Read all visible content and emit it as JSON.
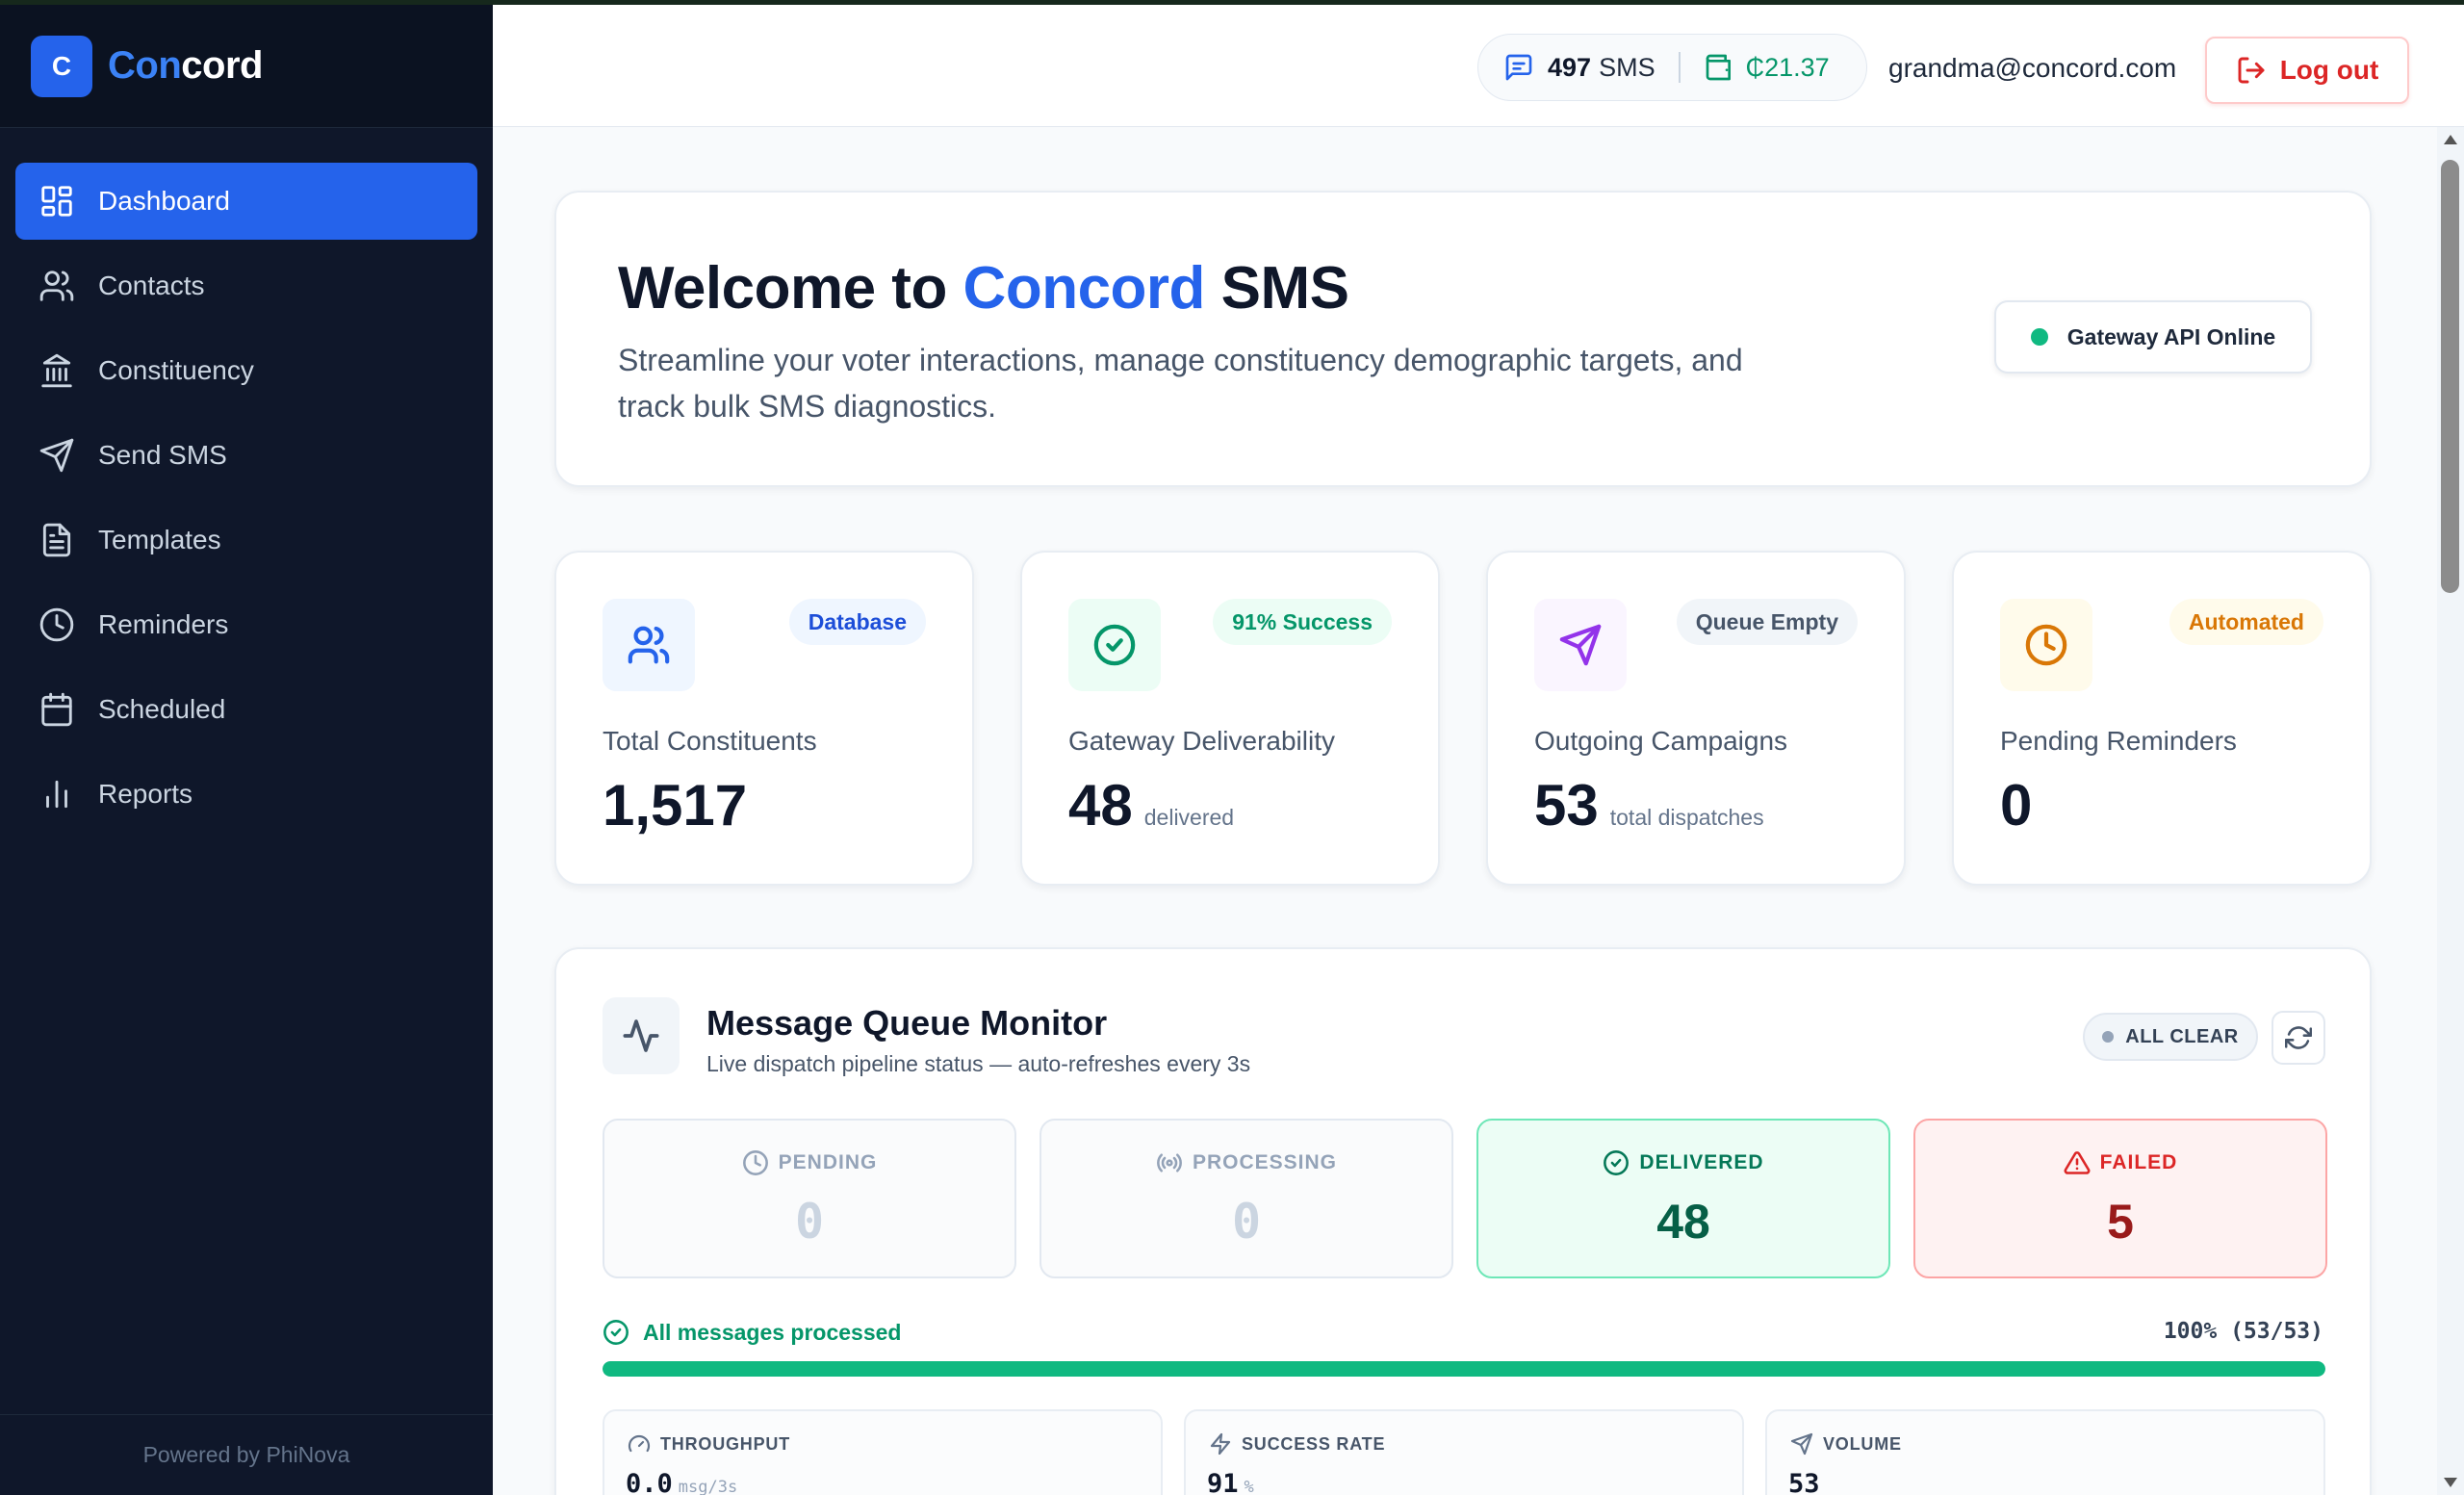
{
  "app": {
    "logo_letter": "C",
    "name_part1": "Con",
    "name_part2": "cord",
    "footer": "Powered by PhiNova"
  },
  "sidebar": {
    "items": [
      {
        "label": "Dashboard",
        "icon": "grid-icon",
        "active": true
      },
      {
        "label": "Contacts",
        "icon": "users-icon",
        "active": false
      },
      {
        "label": "Constituency",
        "icon": "landmark-icon",
        "active": false
      },
      {
        "label": "Send SMS",
        "icon": "send-icon",
        "active": false
      },
      {
        "label": "Templates",
        "icon": "file-text-icon",
        "active": false
      },
      {
        "label": "Reminders",
        "icon": "clock-icon",
        "active": false
      },
      {
        "label": "Scheduled",
        "icon": "calendar-icon",
        "active": false
      },
      {
        "label": "Reports",
        "icon": "bar-chart-icon",
        "active": false
      }
    ]
  },
  "header": {
    "sms_count": "497",
    "sms_label": "SMS",
    "balance": "₵21.37",
    "user_email": "grandma@concord.com",
    "logout_label": "Log out"
  },
  "welcome": {
    "title_prefix": "Welcome to ",
    "title_accent": "Concord",
    "title_suffix": " SMS",
    "subtitle": "Streamline your voter interactions, manage constituency demographic targets, and track bulk SMS diagnostics.",
    "gateway_status": "Gateway API Online"
  },
  "stats": [
    {
      "label": "Total Constituents",
      "value": "1,517",
      "sub": "",
      "badge": "Database",
      "icon": "users-icon",
      "color": "#2563eb",
      "bg": "#eff6ff",
      "badge_bg": "#eff6ff"
    },
    {
      "label": "Gateway Deliverability",
      "value": "48",
      "sub": "delivered",
      "badge": "91% Success",
      "icon": "check-circle-icon",
      "color": "#059669",
      "bg": "#ecfdf5",
      "badge_bg": "#ecfdf5"
    },
    {
      "label": "Outgoing Campaigns",
      "value": "53",
      "sub": "total dispatches",
      "badge": "Queue Empty",
      "icon": "send-icon",
      "color": "#9333ea",
      "bg": "#faf5ff",
      "badge_bg": "#f1f5f9",
      "badge_color": "#475569"
    },
    {
      "label": "Pending Reminders",
      "value": "0",
      "sub": "",
      "badge": "Automated",
      "icon": "clock-icon",
      "color": "#d97706",
      "bg": "#fffbeb",
      "badge_bg": "#fffbeb"
    }
  ],
  "queue": {
    "title": "Message Queue Monitor",
    "subtitle": "Live dispatch pipeline status — auto-refreshes every 3s",
    "status_badge": "ALL CLEAR",
    "boxes": [
      {
        "label": "PENDING",
        "value": "0",
        "icon": "clock-icon"
      },
      {
        "label": "PROCESSING",
        "value": "0",
        "icon": "radio-icon"
      },
      {
        "label": "DELIVERED",
        "value": "48",
        "icon": "check-circle-icon"
      },
      {
        "label": "FAILED",
        "value": "5",
        "icon": "alert-triangle-icon"
      }
    ],
    "processed_label": "All messages processed",
    "progress_text": "100% (53/53)",
    "progress_fraction": 1.0,
    "metrics": [
      {
        "label": "THROUGHPUT",
        "value": "0.0",
        "unit": "msg/3s",
        "icon": "gauge-icon"
      },
      {
        "label": "SUCCESS RATE",
        "value": "91",
        "unit": "%",
        "icon": "zap-icon"
      },
      {
        "label": "VOLUME",
        "value": "53",
        "unit": "",
        "icon": "send-icon"
      }
    ]
  }
}
